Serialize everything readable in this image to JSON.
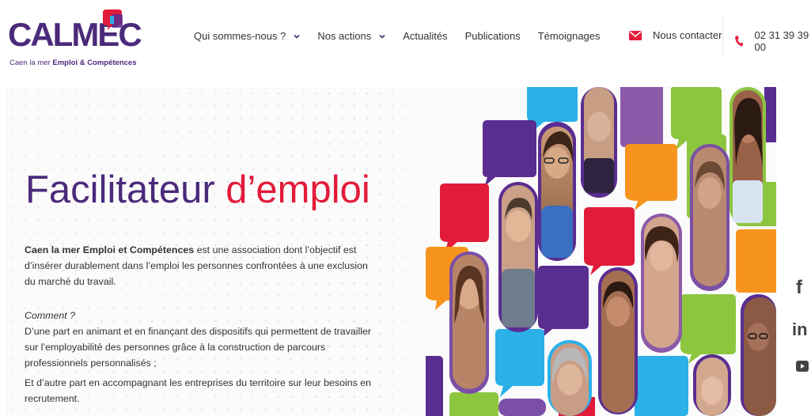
{
  "brand": {
    "logo_text": "CALMEC",
    "tagline_prefix": "Caen la mer ",
    "tagline_bold": "Emploi & Compétences",
    "primary_color": "#4b2a7b",
    "accent_color": "#e21b3a"
  },
  "nav": {
    "items": [
      {
        "label": "Qui sommes-nous ?",
        "dropdown": true
      },
      {
        "label": "Nos actions",
        "dropdown": true
      },
      {
        "label": "Actualités",
        "dropdown": false
      },
      {
        "label": "Publications",
        "dropdown": false
      },
      {
        "label": "Témoignages",
        "dropdown": false
      }
    ]
  },
  "contact": {
    "label": "Nous contacter",
    "icon": "mail-icon"
  },
  "phone": {
    "number": "02 31 39 39 00",
    "icon": "phone-icon"
  },
  "hero": {
    "title_part1": "Facilitateur ",
    "title_part2": "d’emploi",
    "intro_bold": "Caen la mer Emploi et Compétences",
    "intro_rest": " est une association dont l’objectif est d’insérer durablement dans l’emploi les personnes confrontées à une exclusion du marché du travail.",
    "question": "Comment ?",
    "paragraph_1": "D’une part en animant et en finançant des dispositifs qui permettent de travailler sur l’employabilité des personnes grâce à la construction de parcours professionnels personnalisés ;",
    "paragraph_2": "Et d’autre part en accompagnant les entreprises du territoire sur leur besoins en recrutement."
  },
  "social": [
    {
      "name": "facebook-icon",
      "glyph": "f"
    },
    {
      "name": "linkedin-icon",
      "glyph": "in"
    },
    {
      "name": "youtube-icon",
      "glyph": "▶"
    }
  ],
  "collage_colors": [
    "#2bb0e8",
    "#5a2d91",
    "#e21b3a",
    "#f7941d",
    "#8cc63f"
  ]
}
